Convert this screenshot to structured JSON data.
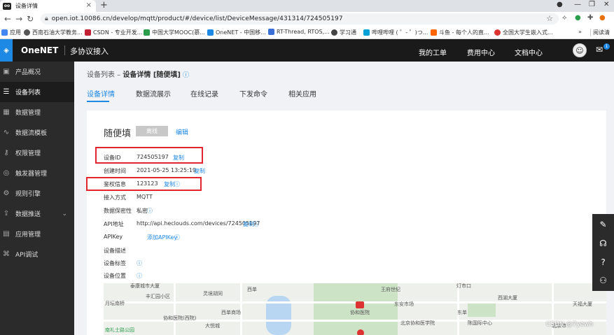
{
  "browser": {
    "tab_title": "设备详情",
    "tab_favicon": "oo",
    "tab_close": "×",
    "new_tab": "+",
    "url": "open.iot.10086.cn/develop/mqtt/product/#/device/list/DeviceMessage/431314/724505197",
    "bookmarks": [
      {
        "label": "应用",
        "color": "#4285f4"
      },
      {
        "label": "西南石油大学教务...",
        "color": "#555"
      },
      {
        "label": "CSDN - 专业开发...",
        "color": "#c32136"
      },
      {
        "label": "中国大学MOOC(慕...",
        "color": "#2a9d4a"
      },
      {
        "label": "OneNET - 中国移...",
        "color": "#1e88e5"
      },
      {
        "label": "RT-Thread, RTOS,...",
        "color": "#3a6fd8"
      },
      {
        "label": "学习通",
        "color": "#444"
      },
      {
        "label": "哔哩哔哩 ( ゜- ゜)つ...",
        "color": "#00a1d6"
      },
      {
        "label": "斗鱼 - 每个人的直...",
        "color": "#f60"
      },
      {
        "label": "全国大学生嵌入式...",
        "color": "#d33"
      }
    ],
    "bookmarks_more": "»",
    "reading_list": "阅读清"
  },
  "header": {
    "logo_mark": "◈",
    "logo": "OneNET",
    "subtitle": "多协议接入",
    "links": [
      "我的工单",
      "费用中心",
      "文档中心"
    ],
    "mail_badge": "1"
  },
  "sidebar": {
    "items": [
      {
        "label": "产品概况",
        "icon": "cube-icon",
        "glyph": "▣"
      },
      {
        "label": "设备列表",
        "icon": "list-icon",
        "glyph": "☰"
      },
      {
        "label": "数据管理",
        "icon": "grid-icon",
        "glyph": "▦"
      },
      {
        "label": "数据流模板",
        "icon": "chart-line-icon",
        "glyph": "∿"
      },
      {
        "label": "权限管理",
        "icon": "key-icon",
        "glyph": "⚷"
      },
      {
        "label": "触发器管理",
        "icon": "trigger-icon",
        "glyph": "◎"
      },
      {
        "label": "规则引擎",
        "icon": "rule-icon",
        "glyph": "⚙"
      },
      {
        "label": "数据推送",
        "icon": "push-icon",
        "glyph": "⇪"
      },
      {
        "label": "应用管理",
        "icon": "app-icon",
        "glyph": "▤"
      },
      {
        "label": "API调试",
        "icon": "api-icon",
        "glyph": "⌘"
      }
    ],
    "active_index": 1,
    "expand_arrow": "⌄"
  },
  "content": {
    "breadcrumb_root": "设备列表 – ",
    "breadcrumb_current": "设备详情 [随便填]",
    "help_glyph": "ⓘ",
    "tabs": [
      "设备详情",
      "数据流展示",
      "在线记录",
      "下发命令",
      "相关应用"
    ],
    "device_name": "随便填",
    "status": "离线",
    "edit": "编辑",
    "fields": {
      "device_id": {
        "key": "设备ID",
        "value": "724505197",
        "action": "复制"
      },
      "created": {
        "key": "创建时间",
        "value": "2021-05-25 13:25:19",
        "action": "复制"
      },
      "auth": {
        "key": "鉴权信息",
        "value": "123123",
        "action": "复制"
      },
      "protocol": {
        "key": "接入方式",
        "value": "MQTT"
      },
      "privacy": {
        "key": "数据保密性",
        "value": "私密"
      },
      "api_addr": {
        "key": "API地址",
        "value": "http://api.heclouds.com/devices/724505197",
        "action": "复制"
      },
      "apikey": {
        "key": "APIKey",
        "action": "添加APIKey"
      },
      "desc": {
        "key": "设备描述"
      },
      "tags": {
        "key": "设备标签"
      },
      "location": {
        "key": "设备位置"
      }
    },
    "map_labels": [
      "泰康城市大厦",
      "丰汇园小区",
      "月坛南桥",
      "西单商场",
      "协和医院(西院)",
      "大悦城",
      "灵境胡同",
      "王府世纪",
      "东安市场",
      "协和医院",
      "北京协和医学院",
      "灯市口",
      "西湖大厦",
      "天福大厦",
      "北京市",
      "陈国际中心",
      "东单",
      "西单",
      "南礼士路公园"
    ]
  },
  "float_tools": [
    "pencil-icon",
    "headset-icon",
    "question-icon",
    "people-icon"
  ],
  "watermark": "CSDN @7yewh"
}
